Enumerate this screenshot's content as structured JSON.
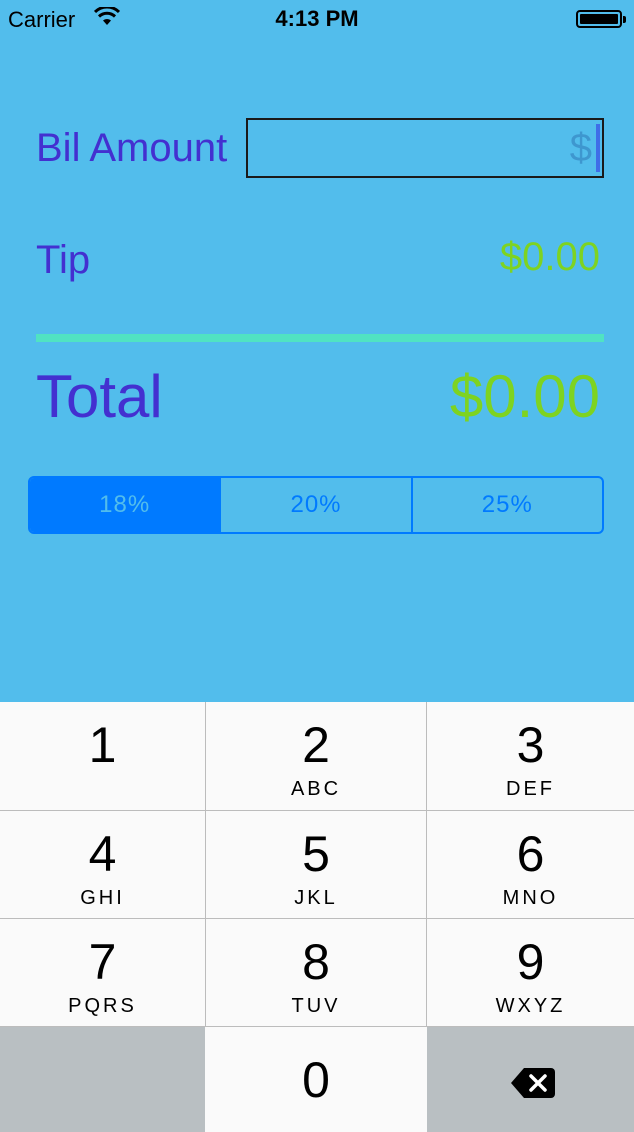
{
  "status_bar": {
    "carrier": "Carrier",
    "time": "4:13 PM",
    "wifi_icon": "wifi-icon",
    "battery_icon": "battery-icon"
  },
  "form": {
    "bill_label": "Bil Amount",
    "bill_placeholder": "$",
    "bill_value": "",
    "tip_label": "Tip",
    "tip_value": "$0.00",
    "total_label": "Total",
    "total_value": "$0.00"
  },
  "tip_selector": {
    "options": [
      "18%",
      "20%",
      "25%"
    ],
    "selected": "18%"
  },
  "keypad": {
    "keys": [
      {
        "digit": "1",
        "letters": ""
      },
      {
        "digit": "2",
        "letters": "ABC"
      },
      {
        "digit": "3",
        "letters": "DEF"
      },
      {
        "digit": "4",
        "letters": "GHI"
      },
      {
        "digit": "5",
        "letters": "JKL"
      },
      {
        "digit": "6",
        "letters": "MNO"
      },
      {
        "digit": "7",
        "letters": "PQRS"
      },
      {
        "digit": "8",
        "letters": "TUV"
      },
      {
        "digit": "9",
        "letters": "WXYZ"
      },
      {
        "digit": "0",
        "letters": ""
      }
    ],
    "delete_icon": "backspace-icon"
  },
  "colors": {
    "background": "#52bdec",
    "label": "#4330d0",
    "amount": "#7ed321",
    "divider": "#50e3c2",
    "accent": "#007aff",
    "keypad_dark": "#b9bfc2"
  }
}
